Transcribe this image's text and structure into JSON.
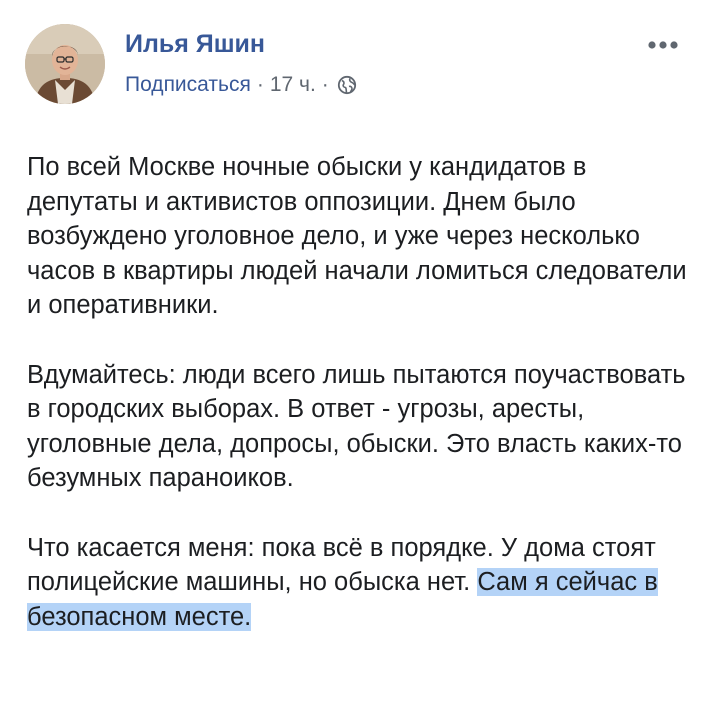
{
  "author": {
    "name": "Илья Яшин"
  },
  "meta": {
    "subscribe_label": "Подписаться",
    "separator": "·",
    "time": "17 ч.",
    "privacy_icon": "globe-icon"
  },
  "more_menu": {
    "icon": "more-dots-icon"
  },
  "post": {
    "paragraphs": [
      "По всей Москве ночные обыски у кандидатов в депутаты и активистов оппозиции. Днем было возбуждено уголовное дело, и уже через несколько часов в квартиры людей начали ломиться следователи и оперативники.",
      "Вдумайтесь: люди всего лишь пытаются поучаствовать в городских выборах. В ответ - угрозы, аресты, уголовные дела, допросы, обыски. Это власть каких-то безумных параноиков."
    ],
    "last_paragraph": {
      "text": "Что касается меня: пока всё в порядке. У дома стоят полицейские машины, но обыска нет. ",
      "selected_text": "Сам я сейчас в безопасном месте."
    }
  },
  "colors": {
    "link": "#385898",
    "secondary_text": "#606770",
    "body_text": "#1c1e21",
    "selection": "#b4d3f7"
  }
}
